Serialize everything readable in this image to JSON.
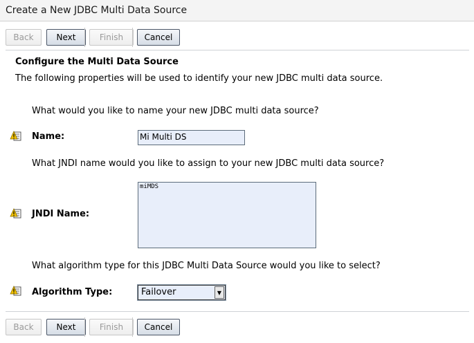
{
  "page_title": "Create a New JDBC Multi Data Source",
  "buttons": {
    "back": "Back",
    "next": "Next",
    "finish": "Finish",
    "cancel": "Cancel"
  },
  "section": {
    "title": "Configure the Multi Data Source",
    "description": "The following properties will be used to identify your new JDBC multi data source."
  },
  "fields": {
    "name": {
      "question": "What would you like to name your new JDBC multi data source?",
      "label": "Name:",
      "value": "Mi Multi DS"
    },
    "jndi": {
      "question": "What JNDI name would you like to assign to your new JDBC multi data source?",
      "label": "JNDI Name:",
      "value": "miMDS"
    },
    "algorithm": {
      "question": "What algorithm type for this JDBC Multi Data Source would you like to select?",
      "label": "Algorithm Type:",
      "value": "Failover"
    }
  },
  "icons": {
    "help": "help-icon",
    "dropdown": "chevron-down-icon"
  },
  "colors": {
    "input_bg": "#e8eefa",
    "title_bar_bg": "#f4f4f4"
  }
}
